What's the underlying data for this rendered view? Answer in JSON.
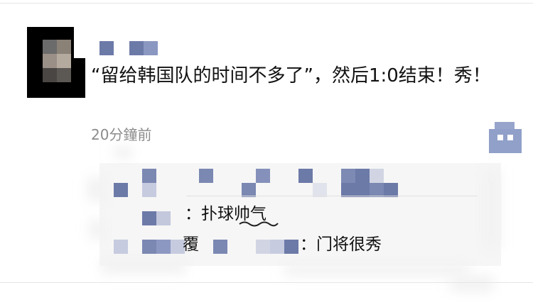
{
  "post": {
    "content": "“留给韩国队的时间不多了”，然后1:0结束！秀！",
    "timestamp": "20分鐘前"
  },
  "comments": [
    {
      "separator": "：",
      "text": "扑球帅气"
    },
    {
      "name_fragment": "覆",
      "separator": "：",
      "text": "门将很秀"
    }
  ],
  "icons": {
    "action": "comment-like-icon"
  },
  "colors": {
    "redaction": "#6c7aa8",
    "panel_bg": "#f6f6f6",
    "timestamp": "#8b8b8b"
  }
}
